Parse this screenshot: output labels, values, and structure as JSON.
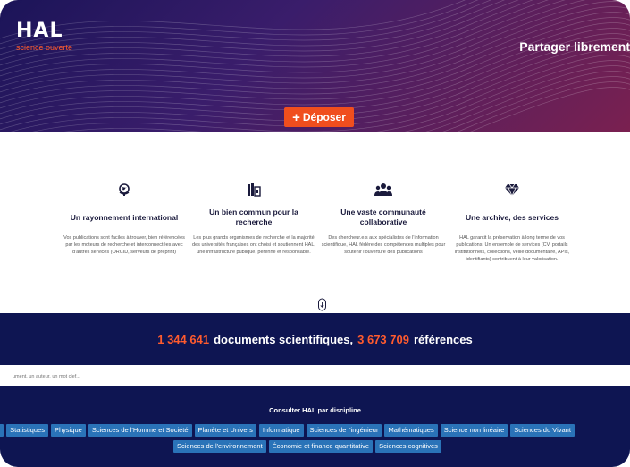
{
  "brand": {
    "logo_text": "HAL",
    "logo_sub": "science ouverte"
  },
  "hero": {
    "tagline": "Partager librement",
    "deposit_label": "Déposer",
    "deposit_icon": "plus-icon"
  },
  "features": [
    {
      "icon": "globe-icon",
      "title": "Un rayonnement international",
      "text": "Vos publications sont faciles à trouver, bien référencées par les moteurs de recherche et interconnectées avec d'autres services (ORCID, serveurs de preprint)"
    },
    {
      "icon": "books-icon",
      "title": "Un bien commun pour la recherche",
      "text": "Les plus grands organismes de recherche et la majorité des universités françaises ont choisi et soutiennent HAL, une infrastructure publique, pérenne et responsable."
    },
    {
      "icon": "users-icon",
      "title": "Une vaste communauté collaborative",
      "text": "Des chercheur.e.s aux spécialistes de l'information scientifique, HAL fédère des compétences multiples pour soutenir l'ouverture des publications"
    },
    {
      "icon": "diamond-icon",
      "title": "Une archive, des services",
      "text": "HAL garantit la préservation à long terme de vos publications. Un ensemble de services (CV, portails institutionnels, collections, veille documentaire, APIs, identifiants) contribuent à leur valorisation."
    }
  ],
  "stats": {
    "documents_count": "1 344 641",
    "documents_label": "documents scientifiques,",
    "references_count": "3 673 709",
    "references_label": "références"
  },
  "search": {
    "placeholder": "ument, un auteur, un mot clef..."
  },
  "disciplines": {
    "heading": "Consulter HAL par discipline",
    "row1": [
      "e",
      "Statistiques",
      "Physique",
      "Sciences de l'Homme et Société",
      "Planète et Univers",
      "Informatique",
      "Sciences de l'ingénieur",
      "Mathématiques",
      "Science non linéaire",
      "Sciences du Vivant"
    ],
    "row2": [
      "Sciences de l'environnement",
      "Économie et finance quantitative",
      "Sciences cognitives"
    ]
  },
  "colors": {
    "accent": "#f04e1e",
    "navy": "#0e1552",
    "tag": "#2a73b8"
  }
}
